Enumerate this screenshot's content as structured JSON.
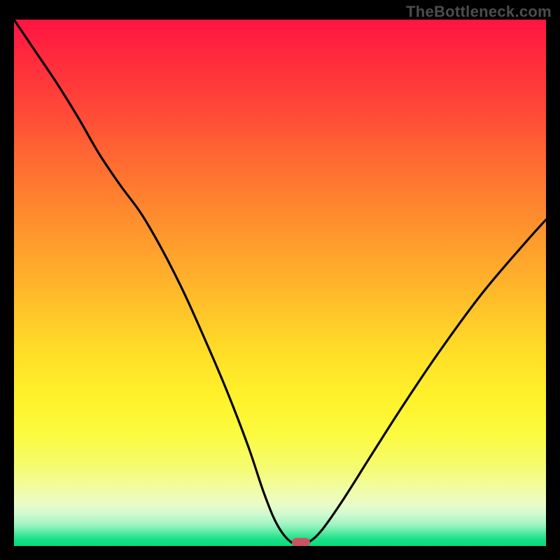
{
  "watermark": "TheBottleneck.com",
  "chart_data": {
    "type": "line",
    "title": "",
    "xlabel": "",
    "ylabel": "",
    "xlim": [
      0,
      100
    ],
    "ylim": [
      0,
      100
    ],
    "x": [
      0,
      4,
      8,
      12,
      16,
      20,
      24,
      28,
      32,
      36,
      40,
      44,
      47,
      49.5,
      52,
      54,
      55.5,
      58,
      62,
      67,
      73,
      80,
      88,
      96,
      100
    ],
    "values": [
      100,
      94,
      88,
      81.5,
      74.5,
      68.5,
      63,
      56,
      48,
      39,
      29.5,
      19,
      10,
      4,
      0.8,
      0.6,
      0.8,
      3.2,
      9,
      17,
      26.5,
      37,
      48,
      57.5,
      62
    ],
    "marker": {
      "x": 54,
      "y": 0.7
    },
    "gradient_colors": {
      "top": "#ff1443",
      "mid_upper": "#ff8b2e",
      "mid": "#ffe028",
      "mid_lower": "#f5fb70",
      "bottom": "#06da7d"
    }
  }
}
